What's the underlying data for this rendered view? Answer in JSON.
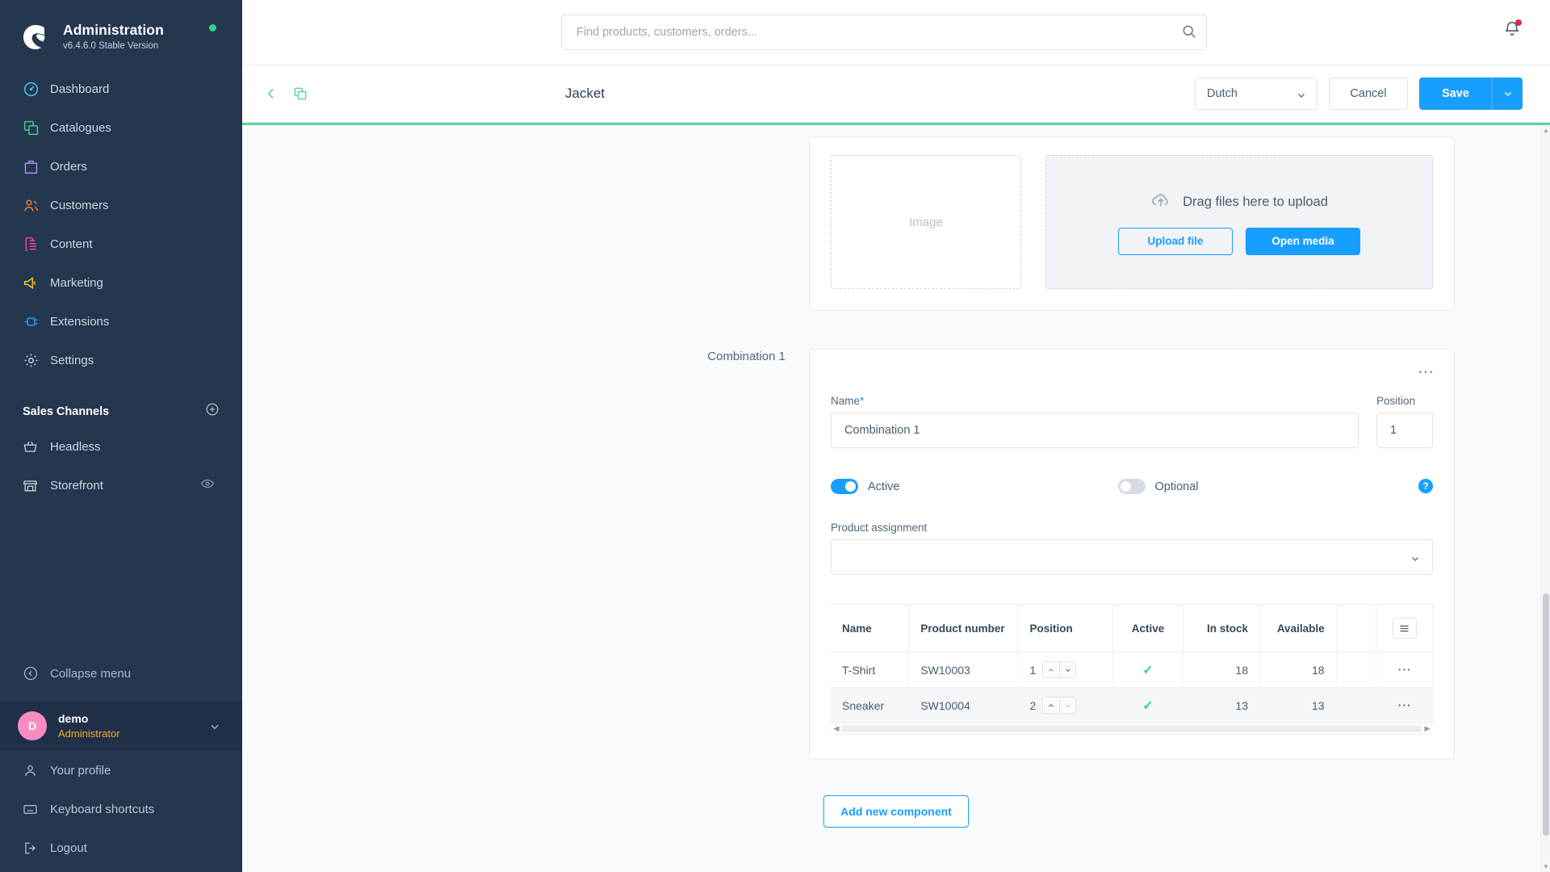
{
  "sidebar": {
    "brand": {
      "title": "Administration",
      "version": "v6.4.6.0 Stable Version"
    },
    "items": [
      {
        "label": "Dashboard",
        "icon": "gauge-icon",
        "color": "#4dc3e6"
      },
      {
        "label": "Catalogues",
        "icon": "catalogues-icon",
        "color": "#3ecf8e"
      },
      {
        "label": "Orders",
        "icon": "bag-icon",
        "color": "#a78bfa"
      },
      {
        "label": "Customers",
        "icon": "users-icon",
        "color": "#f0833a"
      },
      {
        "label": "Content",
        "icon": "content-icon",
        "color": "#f0469b"
      },
      {
        "label": "Marketing",
        "icon": "megaphone-icon",
        "color": "#f5cb24"
      },
      {
        "label": "Extensions",
        "icon": "plug-icon",
        "color": "#2f9bf0"
      },
      {
        "label": "Settings",
        "icon": "gear-icon",
        "color": "#cdd7e2"
      }
    ],
    "sales_channels": {
      "title": "Sales Channels",
      "items": [
        {
          "label": "Headless",
          "icon": "basket-icon"
        },
        {
          "label": "Storefront",
          "icon": "store-icon",
          "trailing_icon": "eye-icon"
        }
      ]
    },
    "collapse_label": "Collapse menu",
    "user": {
      "initial": "D",
      "name": "demo",
      "role": "Administrator"
    },
    "footer_items": [
      {
        "label": "Your profile",
        "icon": "user-icon"
      },
      {
        "label": "Keyboard shortcuts",
        "icon": "keyboard-icon"
      },
      {
        "label": "Logout",
        "icon": "logout-icon"
      }
    ]
  },
  "topbar": {
    "search": {
      "placeholder": "Find products, customers, orders...",
      "value": ""
    },
    "search_icon": "search-icon",
    "notifications_icon": "bell-icon"
  },
  "actionbar": {
    "back_icon": "chevron-left-icon",
    "duplicate_icon": "duplicate-icon",
    "title": "Jacket",
    "language": {
      "value": "Dutch"
    },
    "cancel_label": "Cancel",
    "save_label": "Save",
    "save_caret_icon": "chevron-down-icon"
  },
  "media": {
    "image_placeholder_label": "Image",
    "dropzone_text": "Drag files here to upload",
    "dropzone_icon": "cloud-upload-icon",
    "upload_label": "Upload file",
    "open_media_label": "Open media"
  },
  "combination": {
    "section_label": "Combination 1",
    "more_icon": "ellipsis-icon",
    "name_label": "Name",
    "name_required_mark": "*",
    "name_value": "Combination 1",
    "position_label": "Position",
    "position_value": "1",
    "active_label": "Active",
    "active_on": true,
    "optional_label": "Optional",
    "optional_on": false,
    "help_icon": "help-icon",
    "help_badge_text": "?",
    "assignment_label": "Product assignment",
    "assignment_value": "",
    "assignment_chevron": "chevron-down-icon"
  },
  "table": {
    "columns": [
      "Name",
      "Product number",
      "Position",
      "Active",
      "In stock",
      "Available",
      "",
      ""
    ],
    "settings_icon": "table-settings-icon",
    "rows": [
      {
        "name": "T-Shirt",
        "product_number": "SW10003",
        "position": "1",
        "active": true,
        "active_icon": "check-icon",
        "in_stock": "18",
        "available": "18",
        "row_menu_icon": "ellipsis-icon"
      },
      {
        "name": "Sneaker",
        "product_number": "SW10004",
        "position": "2",
        "active": true,
        "active_icon": "check-icon",
        "in_stock": "13",
        "available": "13",
        "row_menu_icon": "ellipsis-icon"
      }
    ],
    "step_up_icon": "chevron-up-icon",
    "step_down_icon": "chevron-down-icon"
  },
  "footer": {
    "add_component_label": "Add new component"
  },
  "colors": {
    "sidebar_bg": "#24374e",
    "accent_blue": "#189eff",
    "accent_green": "#5ad49b",
    "check_green": "#37d183",
    "status_dot": "#37d183",
    "avatar": "#f88cc0",
    "role_orange": "#f5a623",
    "notification_dot": "#de294c"
  }
}
